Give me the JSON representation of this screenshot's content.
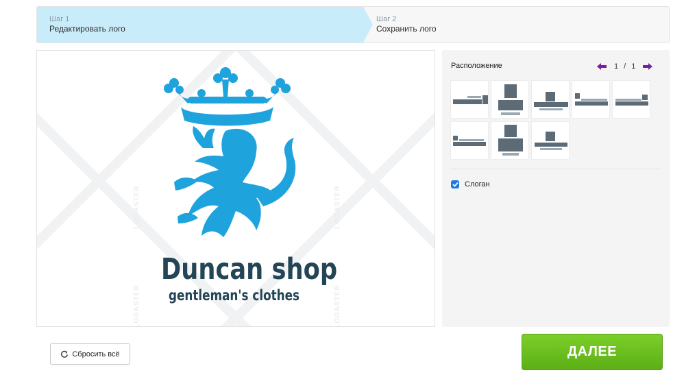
{
  "steps": [
    {
      "num": "Шаг 1",
      "name": "Редактировать лого",
      "active": true
    },
    {
      "num": "Шаг 2",
      "name": "Сохранить лого",
      "active": false
    }
  ],
  "canvas": {
    "watermark": "LOGASTER",
    "logo": {
      "title": "Duncan shop",
      "slogan": "gentleman's clothes",
      "emblem_color": "#1fa3dc",
      "text_color": "#234556"
    }
  },
  "panel": {
    "layout_label": "Расположение",
    "pager": {
      "current": "1",
      "separator": "/",
      "total": "1",
      "arrow_color": "#7a1fa0"
    },
    "slogan_label": "Слоган",
    "slogan_checked": true
  },
  "buttons": {
    "reset_label": "Сбросить всё",
    "next_label": "ДАЛЕЕ"
  }
}
